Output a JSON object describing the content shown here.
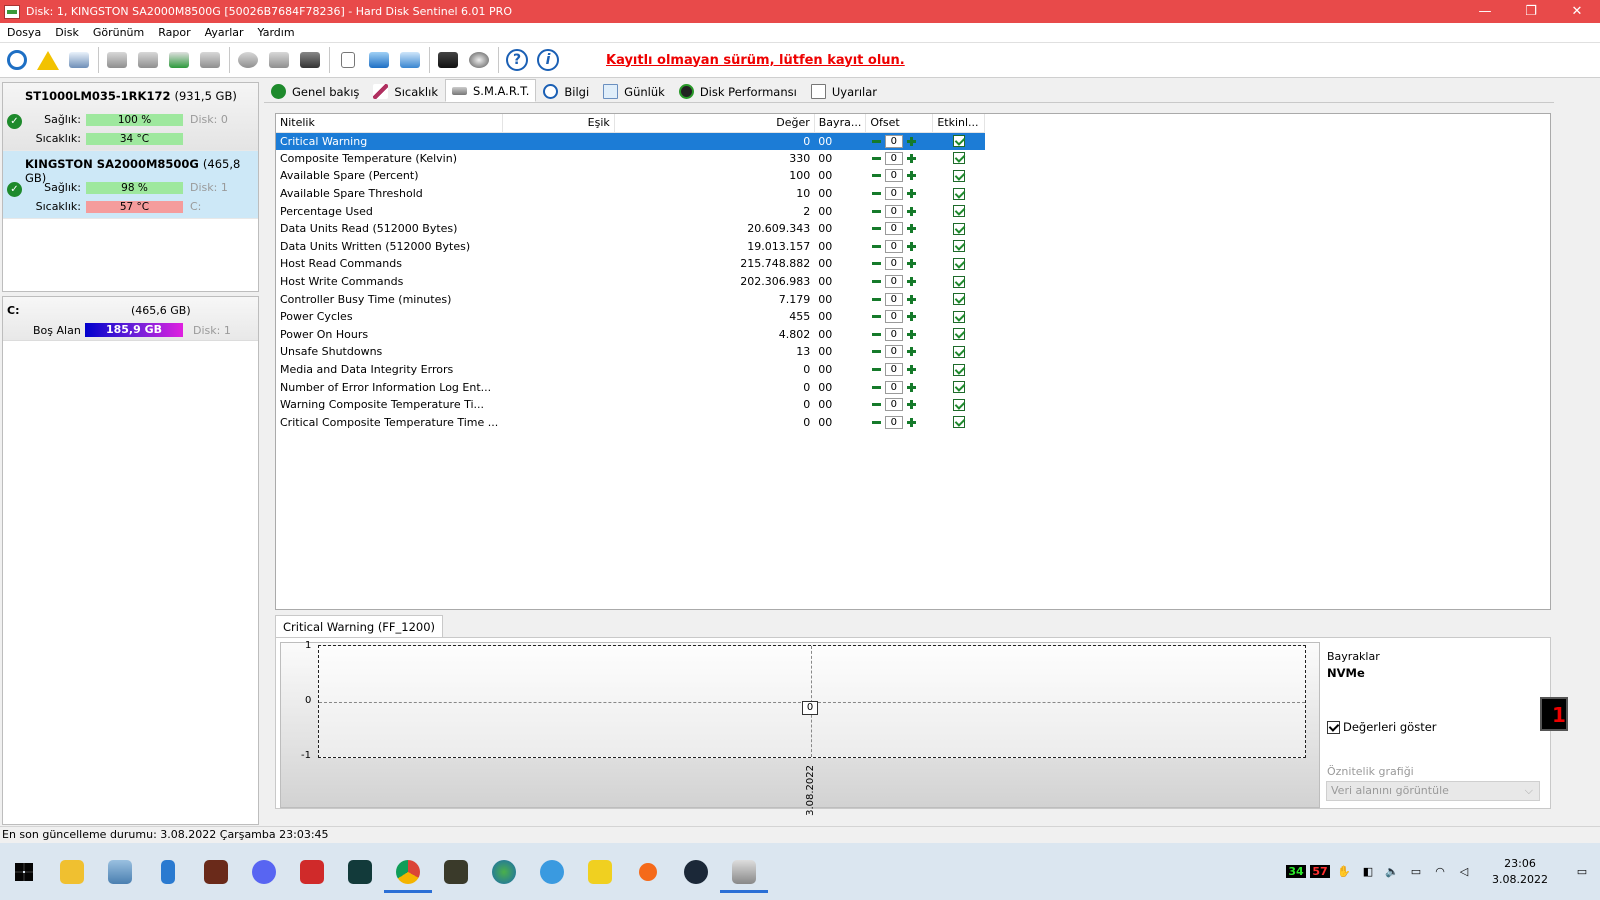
{
  "window": {
    "title": "Disk: 1, KINGSTON SA2000M8500G [50026B7684F78236]  -  Hard Disk Sentinel 6.01 PRO",
    "minimize": "—",
    "restore": "❐",
    "close": "✕"
  },
  "menu": [
    "Dosya",
    "Disk",
    "Görünüm",
    "Rapor",
    "Ayarlar",
    "Yardım"
  ],
  "toolbar": {
    "register_msg": "Kayıtlı olmayan sürüm, lütfen kayıt olun.",
    "icons": [
      "refresh-icon",
      "warning-icon",
      "disk-icon",
      "cloud-disk-icon",
      "disk-test-icon",
      "disk-ok-icon",
      "disk-tool-icon",
      "blob-icon",
      "hdd-icon",
      "drive-icon",
      "report-icon",
      "sync-icon",
      "network-icon",
      "monitor-icon",
      "speaker-icon",
      "help-icon",
      "info-icon"
    ]
  },
  "disks": [
    {
      "name": "ST1000LM035-1RK172",
      "size": "(931,5 GB)",
      "health_label": "Sağlık:",
      "health": "100 %",
      "health_pct": 100,
      "disk_no": "Disk: 0",
      "temp_label": "Sıcaklık:",
      "temp": "34 °C",
      "temp_status": "good",
      "drive_letter": ""
    },
    {
      "name": "KINGSTON SA2000M8500G",
      "size": "(465,8 GB)",
      "health_label": "Sağlık:",
      "health": "98 %",
      "health_pct": 98,
      "disk_no": "Disk: 1",
      "temp_label": "Sıcaklık:",
      "temp": "57 °C",
      "temp_status": "hot",
      "drive_letter": "C:"
    }
  ],
  "partition": {
    "letter": "C:",
    "size": "(465,6 GB)",
    "free_label": "Boş Alan",
    "free": "185,9 GB",
    "disk_no": "Disk: 1"
  },
  "tabs": [
    "Genel bakış",
    "Sıcaklık",
    "S.M.A.R.T.",
    "Bilgi",
    "Günlük",
    "Disk Performansı",
    "Uyarılar"
  ],
  "active_tab": 2,
  "smart": {
    "columns": [
      "Nitelik",
      "Eşik",
      "Değer",
      "Bayra...",
      "Ofset",
      "Etkinl..."
    ],
    "rows": [
      {
        "name": "Critical Warning",
        "esik": "",
        "value": "0",
        "flag": "00",
        "offset": "0",
        "selected": true
      },
      {
        "name": "Composite Temperature (Kelvin)",
        "esik": "",
        "value": "330",
        "flag": "00",
        "offset": "0"
      },
      {
        "name": "Available Spare (Percent)",
        "esik": "",
        "value": "100",
        "flag": "00",
        "offset": "0"
      },
      {
        "name": "Available Spare Threshold",
        "esik": "",
        "value": "10",
        "flag": "00",
        "offset": "0"
      },
      {
        "name": "Percentage Used",
        "esik": "",
        "value": "2",
        "flag": "00",
        "offset": "0"
      },
      {
        "name": "Data Units Read (512000 Bytes)",
        "esik": "",
        "value": "20.609.343",
        "flag": "00",
        "offset": "0"
      },
      {
        "name": "Data Units Written (512000 Bytes)",
        "esik": "",
        "value": "19.013.157",
        "flag": "00",
        "offset": "0"
      },
      {
        "name": "Host Read Commands",
        "esik": "",
        "value": "215.748.882",
        "flag": "00",
        "offset": "0"
      },
      {
        "name": "Host Write Commands",
        "esik": "",
        "value": "202.306.983",
        "flag": "00",
        "offset": "0"
      },
      {
        "name": "Controller Busy Time (minutes)",
        "esik": "",
        "value": "7.179",
        "flag": "00",
        "offset": "0"
      },
      {
        "name": "Power Cycles",
        "esik": "",
        "value": "455",
        "flag": "00",
        "offset": "0"
      },
      {
        "name": "Power On Hours",
        "esik": "",
        "value": "4.802",
        "flag": "00",
        "offset": "0"
      },
      {
        "name": "Unsafe Shutdowns",
        "esik": "",
        "value": "13",
        "flag": "00",
        "offset": "0"
      },
      {
        "name": "Media and Data Integrity Errors",
        "esik": "",
        "value": "0",
        "flag": "00",
        "offset": "0"
      },
      {
        "name": "Number of Error Information Log Ent...",
        "esik": "",
        "value": "0",
        "flag": "00",
        "offset": "0"
      },
      {
        "name": "Warning Composite Temperature Ti...",
        "esik": "",
        "value": "0",
        "flag": "00",
        "offset": "0"
      },
      {
        "name": "Critical Composite Temperature Time ...",
        "esik": "",
        "value": "0",
        "flag": "00",
        "offset": "0"
      }
    ]
  },
  "graph": {
    "tab": "Critical Warning (FF_1200)",
    "y_ticks": [
      "1",
      "0",
      "-1"
    ],
    "point_value": "0",
    "date": "3.08.2022",
    "flags_title": "Bayraklar",
    "flags_value": "NVMe",
    "show_values": "Değerleri göster",
    "attr_graph_label": "Öznitelik grafiği",
    "attr_graph_select": "Veri alanını görüntüle"
  },
  "badge": "1",
  "status": "En son güncelleme durumu: 3.08.2022 Çarşamba 23:03:45",
  "taskbar": {
    "apps": [
      "start-icon",
      "explorer-icon",
      "notepad-icon",
      "usb-icon",
      "game-icon",
      "discord-icon",
      "hand-icon",
      "arc-icon",
      "chrome-icon",
      "pubg-icon",
      "earth-icon",
      "app-icon",
      "player-icon",
      "origin-icon",
      "steam-icon",
      "hdsentinel-icon"
    ],
    "tray_temp1": "34",
    "tray_temp2": "57",
    "time": "23:06",
    "date": "3.08.2022"
  },
  "colors": {
    "titlebar": "#e84a4a",
    "selection": "#1c7cd6",
    "health_good": "#9ee89e",
    "temp_hot": "#f59c9c",
    "register_msg": "#ee0000"
  }
}
